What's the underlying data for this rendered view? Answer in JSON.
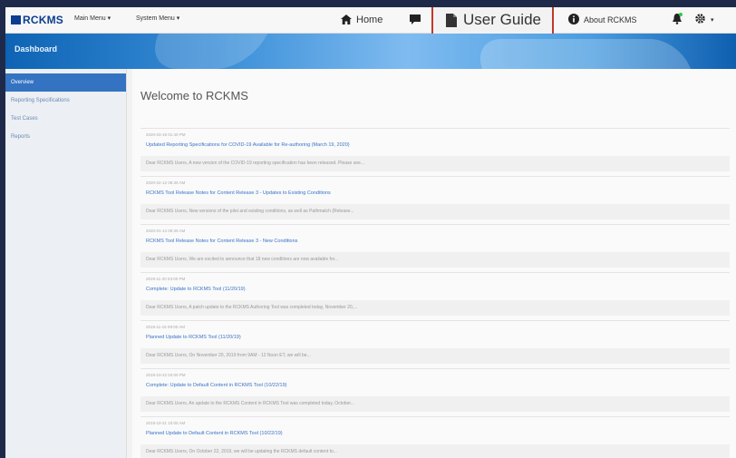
{
  "app": {
    "logo": "RCKMS",
    "banner_title": "Dashboard"
  },
  "navbar": {
    "main_menu": "Main Menu ▾",
    "system_menu": "System Menu ▾",
    "home": "Home",
    "user_guide": "User Guide",
    "about": "About RCKMS"
  },
  "icons": {
    "home": "home-icon",
    "chat": "chat-icon",
    "doc": "document-icon",
    "info": "info-icon",
    "bell": "bell-icon",
    "gear": "gear-icon"
  },
  "sidebar": {
    "items": [
      {
        "label": "Overview"
      },
      {
        "label": "Reporting Specifications"
      },
      {
        "label": "Test Cases"
      },
      {
        "label": "Reports"
      }
    ]
  },
  "main": {
    "welcome": "Welcome to RCKMS",
    "news": [
      {
        "timestamp": "2020-03-19 01:40 PM",
        "title": "Updated Reporting Specifications for COVID-19 Available for Re-authoring (March 19, 2020)",
        "snippet": "Dear RCKMS Users, A new version of the COVID-19 reporting specification has been released. Please see..."
      },
      {
        "timestamp": "2020-02-12 08:30 AM",
        "title": "RCKMS Tool Release Notes for Content Release 3 - Updates to Existing Conditions",
        "snippet": "Dear RCKMS Users, New versions of the pilot and existing conditions, as well as Pathmatch (Release..."
      },
      {
        "timestamp": "2020-01-14 09:30 AM",
        "title": "RCKMS Tool Release Notes for Content Release 3 - New Conditions",
        "snippet": "Dear RCKMS Users, We are excited to announce that 18 new conditions are now available for..."
      },
      {
        "timestamp": "2019-11-20 03:00 PM",
        "title": "Complete: Update to RCKMS Tool (11/20/19)",
        "snippet": "Dear RCKMS Users, A patch update to the RCKMS Authoring Tool was completed today, November 20,..."
      },
      {
        "timestamp": "2019-11-19 09:00 AM",
        "title": "Planned Update to RCKMS Tool (11/20/19)",
        "snippet": "Dear RCKMS Users, On November 20, 2019 from 9AM - 12 Noon ET, we will be..."
      },
      {
        "timestamp": "2019-10-22 04:00 PM",
        "title": "Complete: Update to Default Content in RCKMS Tool (10/22/19)",
        "snippet": "Dear RCKMS Users, An update to the RCKMS Content in RCKMS Tool was completed today, October..."
      },
      {
        "timestamp": "2019-10-21 10:00 AM",
        "title": "Planned Update to Default Content in RCKMS Tool (10/22/19)",
        "snippet": "Dear RCKMS Users, On October 22, 2019, we will be updating the RCKMS default content to..."
      }
    ]
  },
  "colors": {
    "accent": "#3473c1",
    "highlight_border": "#c0392b",
    "link": "#3a72c8"
  }
}
